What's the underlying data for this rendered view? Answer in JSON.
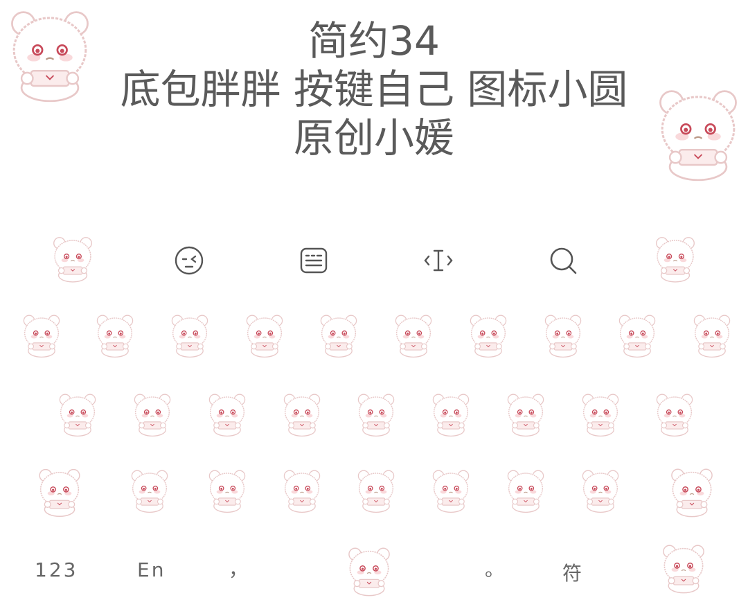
{
  "title": {
    "line1": "简约34",
    "line2": "底包胖胖 按键自己 图标小圆",
    "line3": "原创小媛"
  },
  "toolbar": {
    "icons": [
      "bear-icon",
      "emoji-wink-icon",
      "keyboard-list-icon",
      "text-cursor-icon",
      "search-icon",
      "bear-icon"
    ]
  },
  "bottom_row": {
    "numbers_label": "123",
    "language_label": "En",
    "comma_label": "，",
    "period_label": "。",
    "symbols_label": "符"
  },
  "colors": {
    "title": "#5a5a5a",
    "icon": "#555555",
    "bear_outline": "#e8c8c8",
    "bear_eye": "#c84a5a",
    "bear_blush": "#f6c9cc"
  }
}
